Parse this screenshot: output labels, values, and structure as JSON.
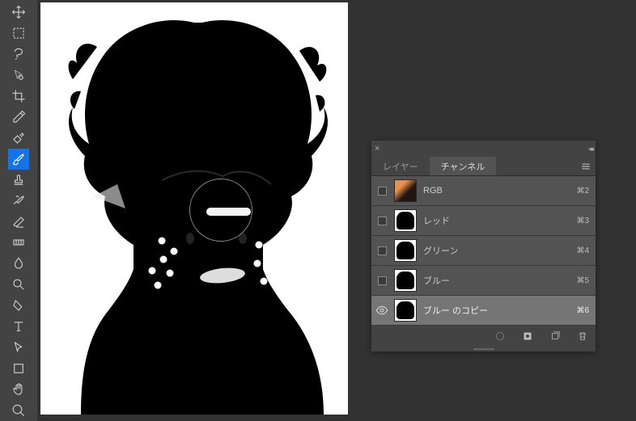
{
  "tools": [
    {
      "name": "move-tool"
    },
    {
      "name": "marquee-tool"
    },
    {
      "name": "lasso-tool"
    },
    {
      "name": "quick-select-tool"
    },
    {
      "name": "crop-tool"
    },
    {
      "name": "eyedropper-tool"
    },
    {
      "name": "healing-tool"
    },
    {
      "name": "brush-tool",
      "active": true
    },
    {
      "name": "stamp-tool"
    },
    {
      "name": "history-brush-tool"
    },
    {
      "name": "eraser-tool"
    },
    {
      "name": "gradient-tool"
    },
    {
      "name": "blur-tool"
    },
    {
      "name": "dodge-tool"
    },
    {
      "name": "pen-tool"
    },
    {
      "name": "type-tool"
    },
    {
      "name": "path-select-tool"
    },
    {
      "name": "shape-tool"
    },
    {
      "name": "hand-tool"
    },
    {
      "name": "zoom-tool"
    }
  ],
  "panel": {
    "tabs": [
      {
        "label": "レイヤー",
        "active": false
      },
      {
        "label": "チャンネル",
        "active": true
      }
    ],
    "channels": [
      {
        "name": "RGB",
        "shortcut": "⌘2",
        "thumb": "rgb",
        "visible": false
      },
      {
        "name": "レッド",
        "shortcut": "⌘3",
        "thumb": "bw",
        "visible": false
      },
      {
        "name": "グリーン",
        "shortcut": "⌘4",
        "thumb": "bw",
        "visible": false
      },
      {
        "name": "ブルー",
        "shortcut": "⌘5",
        "thumb": "bw",
        "visible": false
      },
      {
        "name": "ブルー のコピー",
        "shortcut": "⌘6",
        "thumb": "bw",
        "visible": true,
        "selected": true
      }
    ]
  }
}
